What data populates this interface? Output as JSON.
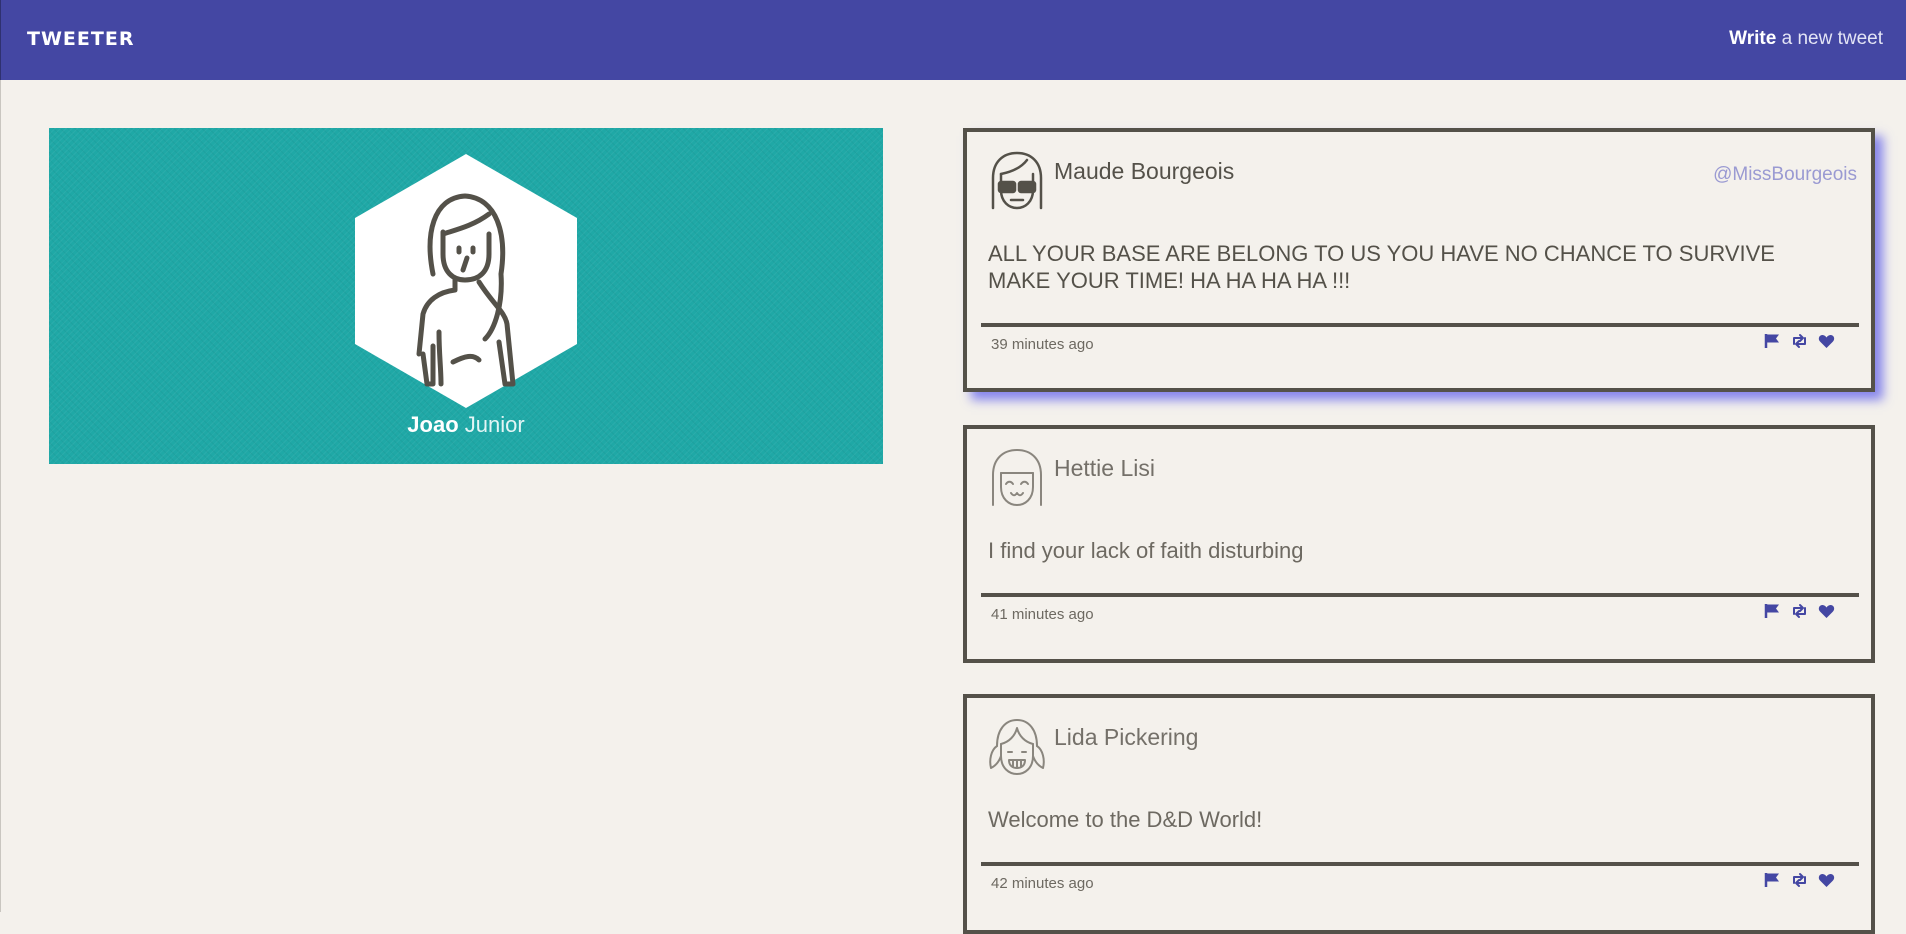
{
  "header": {
    "brand": "TWEETER",
    "compose_strong": "Write",
    "compose_rest": " a new tweet"
  },
  "profile": {
    "first_name": "Joao",
    "last_name": "Junior",
    "banner_color": "#1fa8a6"
  },
  "tweets": [
    {
      "author": "Maude Bourgeois",
      "handle": "@MissBourgeois",
      "text": "ALL YOUR BASE ARE BELONG TO US YOU HAVE NO CHANCE TO SURVIVE MAKE YOUR TIME! HA HA HA HA !!!",
      "time": "39 minutes ago",
      "avatar_icon": "avatar-sunglasses-icon"
    },
    {
      "author": "Hettie Lisi",
      "handle": "",
      "text": "I find your lack of faith disturbing",
      "time": "41 minutes ago",
      "avatar_icon": "avatar-smiling-girl-icon"
    },
    {
      "author": "Lida Pickering",
      "handle": "",
      "text": "Welcome to the D&D World!",
      "time": "42 minutes ago",
      "avatar_icon": "avatar-pigtails-icon"
    }
  ],
  "actions": [
    "flag-icon",
    "retweet-icon",
    "heart-icon"
  ],
  "colors": {
    "nav": "#4447a3",
    "background": "#f4f1ec",
    "ink": "#545149",
    "accent": "#4447a3",
    "shadow": "#6262eb"
  }
}
